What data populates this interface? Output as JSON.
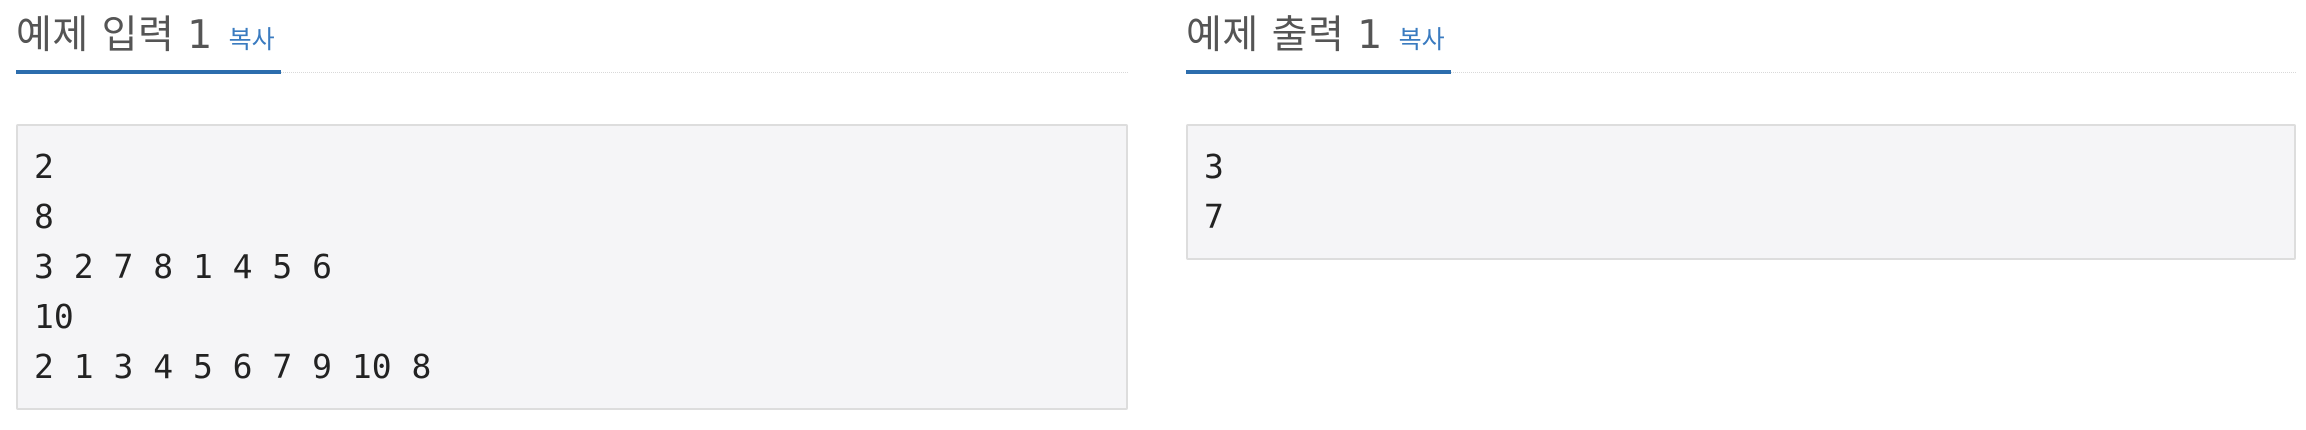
{
  "input_section": {
    "title": "예제 입력 1",
    "copy_label": "복사",
    "lines": [
      "2",
      "8",
      "3 2 7 8 1 4 5 6",
      "10",
      "2 1 3 4 5 6 7 9 10 8"
    ]
  },
  "output_section": {
    "title": "예제 출력 1",
    "copy_label": "복사",
    "lines": [
      "3",
      "7"
    ]
  },
  "colors": {
    "accent": "#2c6dad",
    "link": "#3a7bc0",
    "sample_bg": "#f5f5f7",
    "sample_border": "#dddddd"
  }
}
